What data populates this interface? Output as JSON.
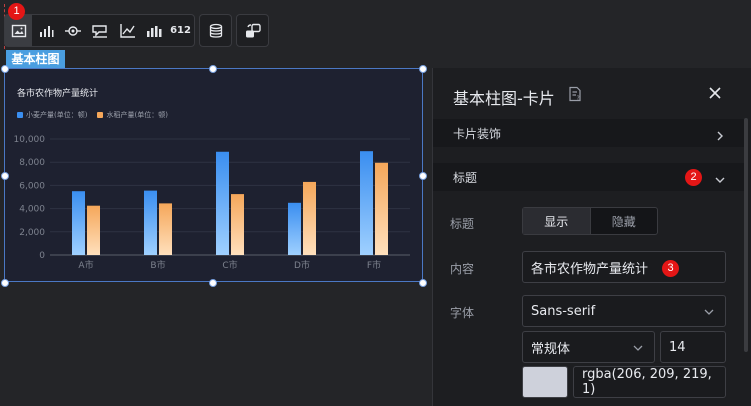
{
  "toolbar": {
    "items": [
      {
        "icon": "picture-card-icon",
        "active": true
      },
      {
        "icon": "bar-chart-icon"
      },
      {
        "icon": "eye-target-icon"
      },
      {
        "icon": "flag-chart-icon"
      },
      {
        "icon": "axis-line-icon"
      },
      {
        "icon": "bar-data-icon"
      },
      {
        "icon": "number-612-icon",
        "text": "612"
      },
      {
        "icon": "database-icon"
      },
      {
        "icon": "interaction-icon"
      }
    ],
    "badge1": "1"
  },
  "component_tag": "基本柱图",
  "chart_data": {
    "type": "bar",
    "title": "各市农作物产量统计",
    "categories": [
      "A市",
      "B市",
      "C市",
      "D市",
      "F市"
    ],
    "series": [
      {
        "name": "小麦产量(单位：顿)",
        "values": [
          5500,
          5550,
          8900,
          4500,
          8950
        ],
        "color_top": "#3a8ef0",
        "color_bottom": "#9fd0ff"
      },
      {
        "name": "水稻产量(单位：顿)",
        "values": [
          4250,
          4450,
          5250,
          6300,
          7950
        ],
        "color_top": "#f5a75a",
        "color_bottom": "#ffe0bd"
      }
    ],
    "yticks": [
      0,
      2000,
      4000,
      6000,
      8000,
      10000
    ],
    "ytick_labels": [
      "0",
      "2,000",
      "4,000",
      "6,000",
      "8,000",
      "10,000"
    ],
    "ylim": [
      0,
      10000
    ],
    "grid": true,
    "legend_position": "top-left"
  },
  "panel": {
    "title": "基本柱图-卡片",
    "section_card": "卡片装饰",
    "section_title": "标题",
    "badge2": "2",
    "title_label": "标题",
    "seg_show": "显示",
    "seg_hide": "隐藏",
    "content_label": "内容",
    "content_value": "各市农作物产量统计",
    "badge3": "3",
    "font_label": "字体",
    "font_family": "Sans-serif",
    "font_weight": "常规体",
    "font_size": "14",
    "color_value": "rgba(206, 209, 219, 1)",
    "color_swatch": "#ced1db"
  }
}
